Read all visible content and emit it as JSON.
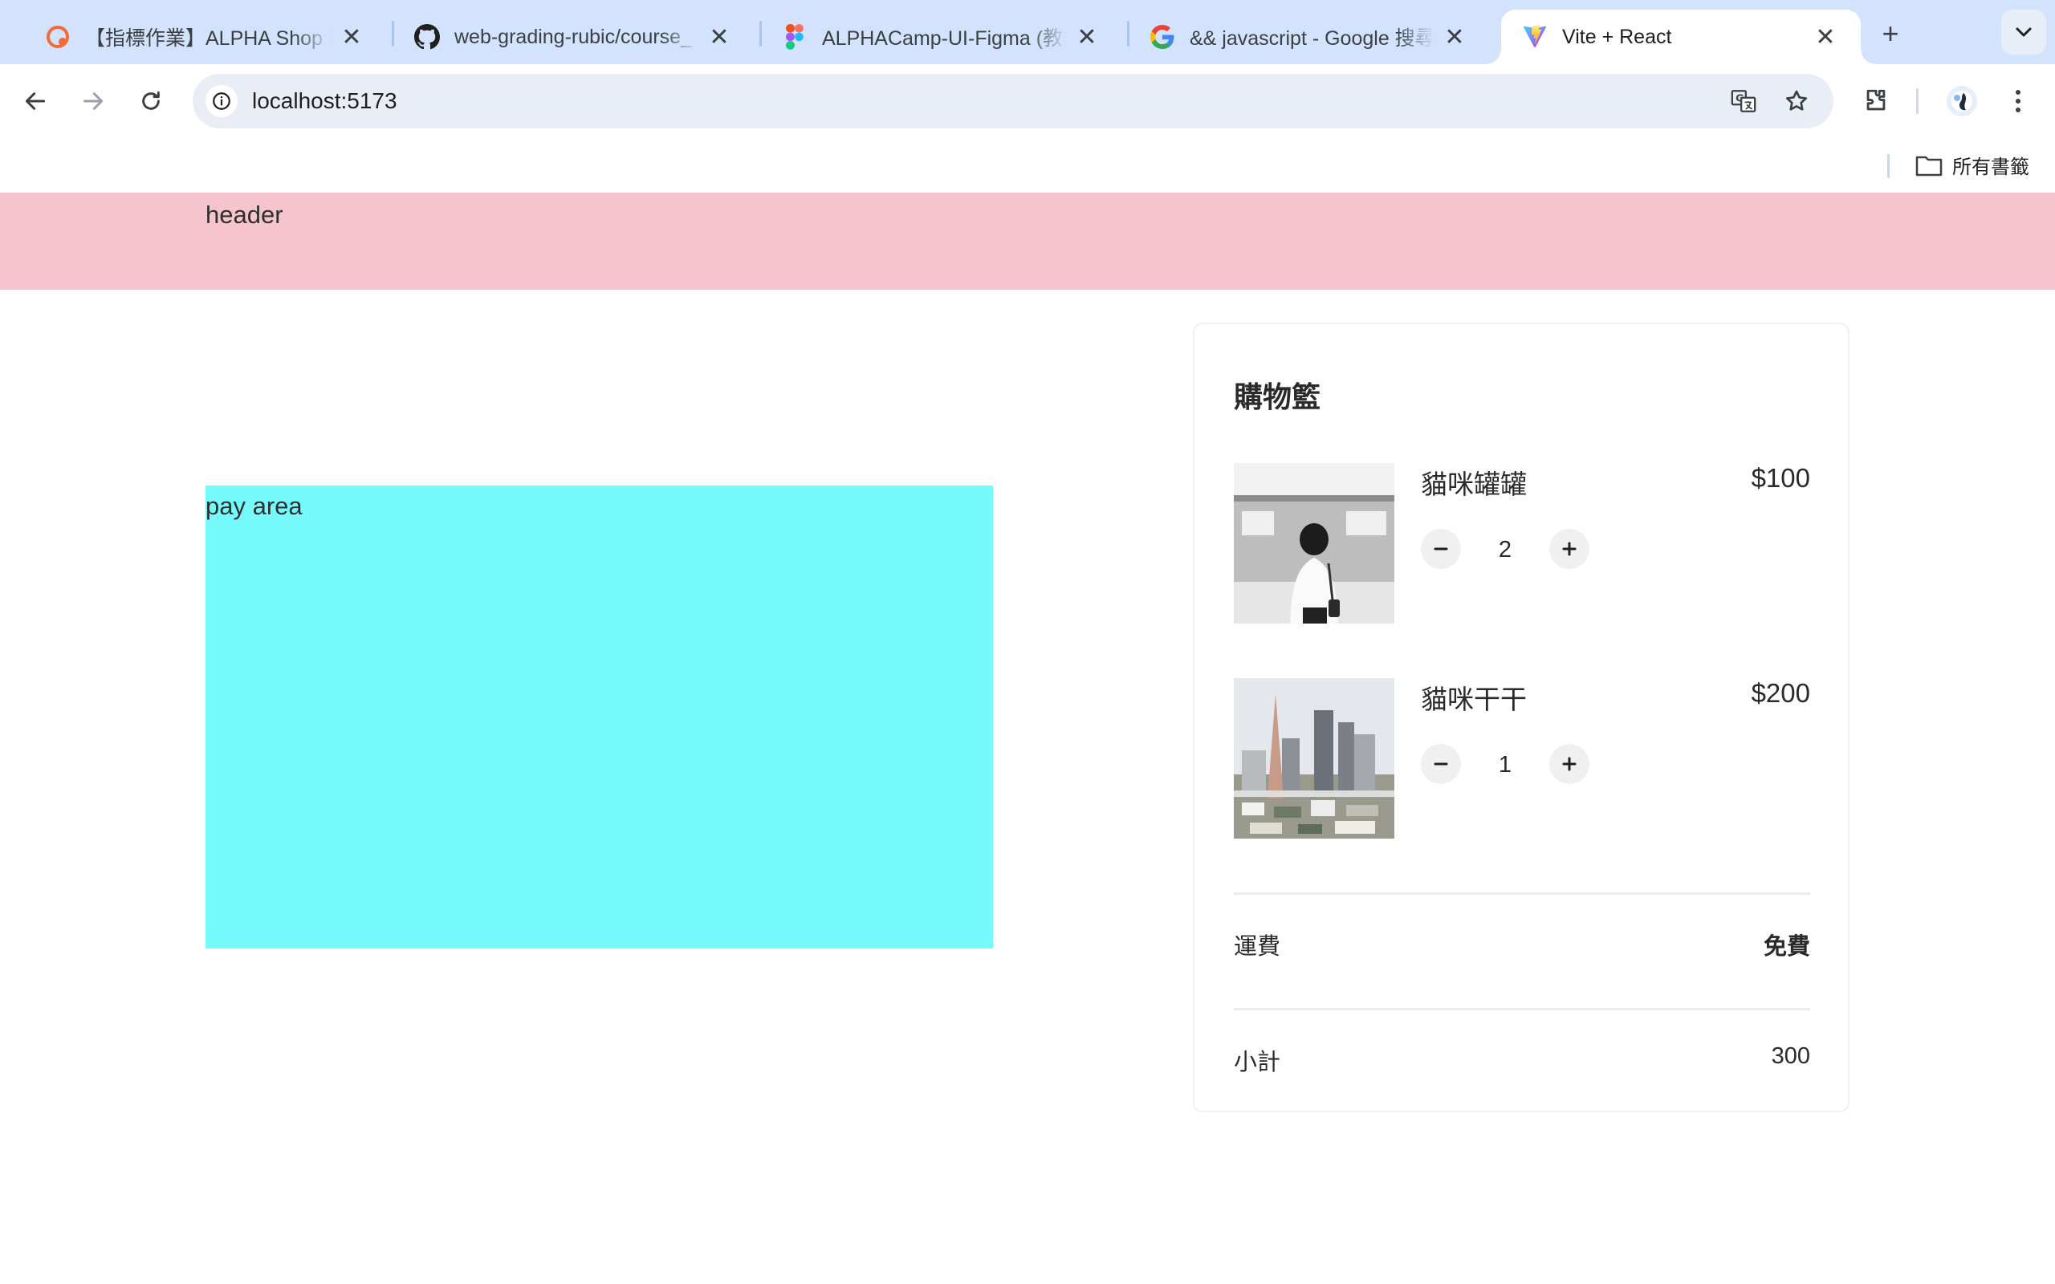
{
  "browser": {
    "tabs": [
      {
        "title": "【指標作業】ALPHA Shop II",
        "favicon": "alpha-camp-icon",
        "active": false
      },
      {
        "title": "web-grading-rubic/course_",
        "favicon": "github-icon",
        "active": false
      },
      {
        "title": "ALPHACamp-UI-Figma (教材",
        "favicon": "figma-icon",
        "active": false
      },
      {
        "title": "&& javascript - Google 搜尋",
        "favicon": "google-icon",
        "active": false
      },
      {
        "title": "Vite + React",
        "favicon": "vite-icon",
        "active": true
      }
    ],
    "url": "localhost:5173",
    "bookmarks": {
      "all_bookmarks_label": "所有書籤"
    }
  },
  "page": {
    "header_text": "header",
    "pay_area_text": "pay area",
    "colors": {
      "header_bg": "#f5c4cc",
      "pay_area_bg": "#76fbfc"
    },
    "cart": {
      "title": "購物籃",
      "items": [
        {
          "name": "貓咪罐罐",
          "price": "$100",
          "quantity": "2",
          "image": "woman-at-train-photo"
        },
        {
          "name": "貓咪干干",
          "price": "$200",
          "quantity": "1",
          "image": "city-skyline-photo"
        }
      ],
      "shipping_label": "運費",
      "shipping_value": "免費",
      "subtotal_label": "小計",
      "subtotal_value": "300"
    }
  }
}
